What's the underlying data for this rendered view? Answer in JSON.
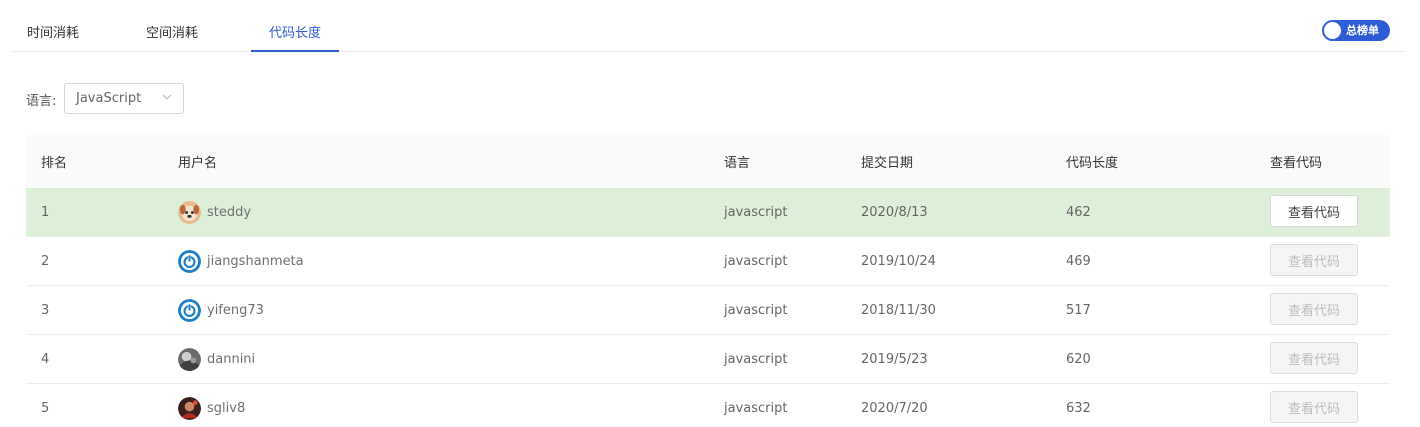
{
  "tabs": [
    {
      "label": "时间消耗",
      "active": false
    },
    {
      "label": "空间消耗",
      "active": false
    },
    {
      "label": "代码长度",
      "active": true
    }
  ],
  "toggle": {
    "label": "总榜单",
    "on": true
  },
  "filter": {
    "label": "语言:",
    "selected": "JavaScript"
  },
  "table": {
    "headers": [
      "排名",
      "用户名",
      "语言",
      "提交日期",
      "代码长度",
      "查看代码"
    ],
    "rows": [
      {
        "rank": "1",
        "user": "steddy",
        "avatar": "dog-avatar",
        "lang": "javascript",
        "date": "2020/8/13",
        "length": "462",
        "action": "查看代码",
        "enabled": true,
        "highlight": true
      },
      {
        "rank": "2",
        "user": "jiangshanmeta",
        "avatar": "power-icon-avatar",
        "lang": "javascript",
        "date": "2019/10/24",
        "length": "469",
        "action": "查看代码",
        "enabled": false
      },
      {
        "rank": "3",
        "user": "yifeng73",
        "avatar": "power-icon-avatar",
        "lang": "javascript",
        "date": "2018/11/30",
        "length": "517",
        "action": "查看代码",
        "enabled": false
      },
      {
        "rank": "4",
        "user": "dannini",
        "avatar": "photo-avatar",
        "lang": "javascript",
        "date": "2019/5/23",
        "length": "620",
        "action": "查看代码",
        "enabled": false
      },
      {
        "rank": "5",
        "user": "sgliv8",
        "avatar": "photo-avatar",
        "lang": "javascript",
        "date": "2020/7/20",
        "length": "632",
        "action": "查看代码",
        "enabled": false
      }
    ]
  },
  "colors": {
    "accent": "#2e5bd6",
    "highlight_row": "#ddefd8"
  }
}
